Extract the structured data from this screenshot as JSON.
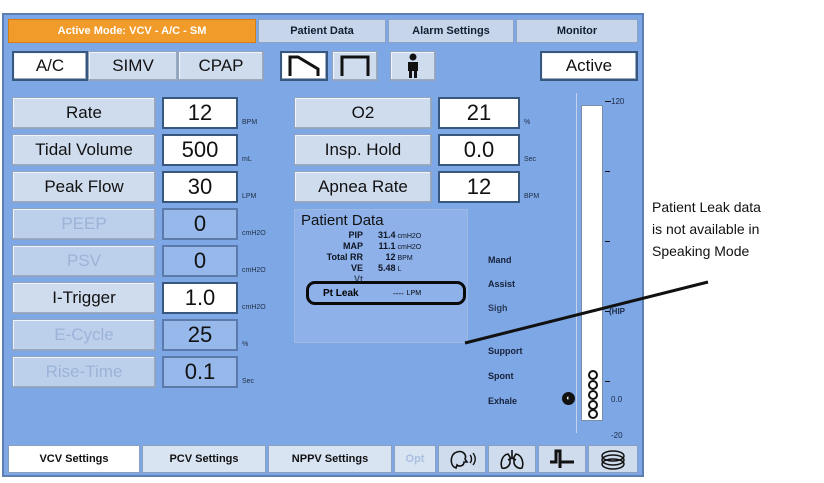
{
  "top_tabs": [
    {
      "label": "Active Mode:  VCV - A/C - SM"
    },
    {
      "label": "Patient Data"
    },
    {
      "label": "Alarm Settings"
    },
    {
      "label": "Monitor"
    }
  ],
  "modes": {
    "ac": "A/C",
    "simv": "SIMV",
    "cpap": "CPAP"
  },
  "status": "Active",
  "left_params": [
    {
      "label": "Rate",
      "value": "12",
      "unit": "BPM"
    },
    {
      "label": "Tidal Volume",
      "value": "500",
      "unit": "mL"
    },
    {
      "label": "Peak Flow",
      "value": "30",
      "unit": "LPM"
    },
    {
      "label": "PEEP",
      "value": "0",
      "unit": "cmH2O"
    },
    {
      "label": "PSV",
      "value": "0",
      "unit": "cmH2O"
    },
    {
      "label": "I-Trigger",
      "value": "1.0",
      "unit": "cmH2O"
    },
    {
      "label": "E-Cycle",
      "value": "25",
      "unit": "%"
    },
    {
      "label": "Rise-Time",
      "value": "0.1",
      "unit": "Sec"
    }
  ],
  "right_params": [
    {
      "label": "O2",
      "value": "21",
      "unit": "%"
    },
    {
      "label": "Insp. Hold",
      "value": "0.0",
      "unit": "Sec"
    },
    {
      "label": "Apnea Rate",
      "value": "12",
      "unit": "BPM"
    }
  ],
  "patient_data": {
    "title": "Patient Data",
    "pip_label": "PIP",
    "pip_value": "31.4",
    "pip_unit": "cmH2O",
    "map_label": "MAP",
    "map_value": "11.1",
    "map_unit": "cmH2O",
    "rr_label": "Total RR",
    "rr_value": "12",
    "rr_unit": "BPM",
    "ve_label": "VE",
    "ve_value": "5.48",
    "ve_unit": "L",
    "vt_label": "Vt",
    "leak_label": "Pt Leak",
    "leak_value": "----",
    "leak_unit": "LPM"
  },
  "breath_types": [
    "Mand",
    "Assist",
    "Sigh",
    "Support",
    "Spont",
    "Exhale"
  ],
  "gauge": {
    "top_label": "120",
    "mid_label": "(HIP",
    "low_label": "0.0",
    "bottom_label": "-20"
  },
  "bottom_tabs": {
    "vcv": "VCV Settings",
    "pcv": "PCV Settings",
    "nppv": "NPPV Settings",
    "opt": "Opt"
  },
  "annotation": {
    "line1": "Patient Leak data",
    "line2": "is not available in",
    "line3": "Speaking Mode"
  }
}
